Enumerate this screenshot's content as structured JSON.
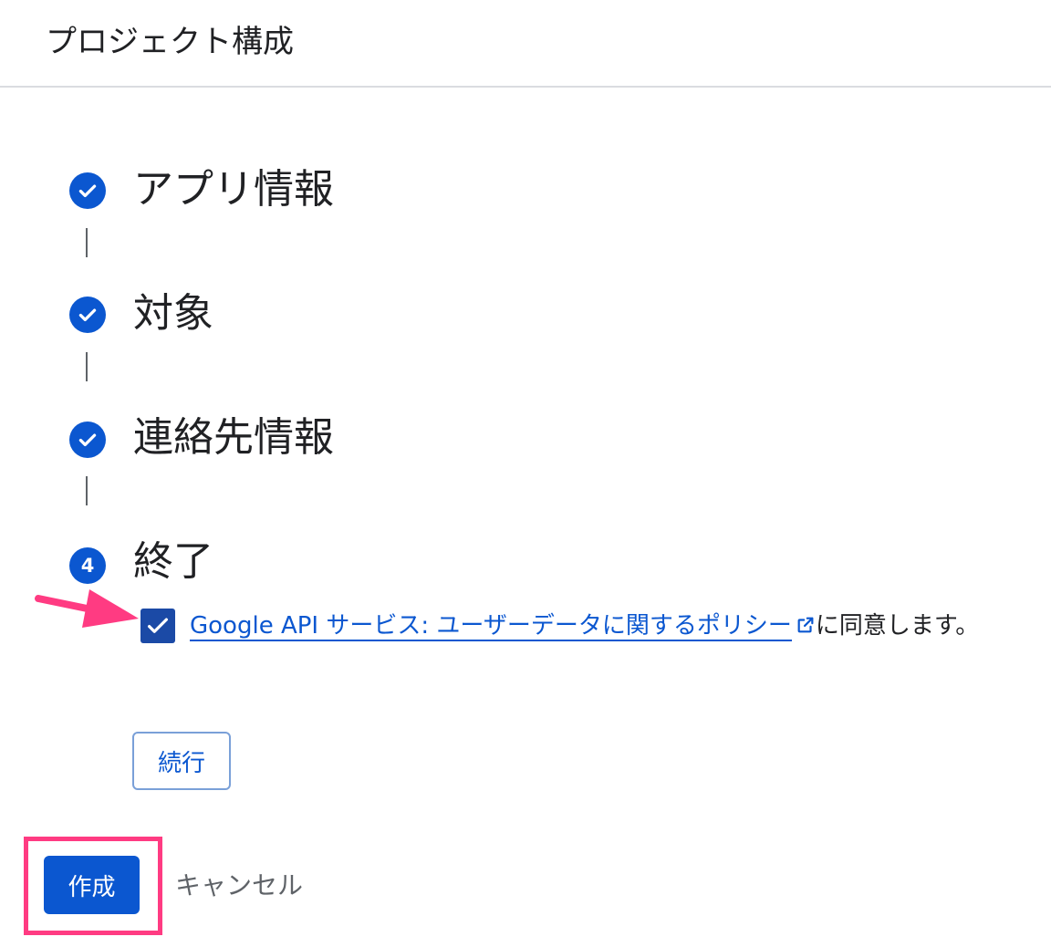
{
  "header": {
    "title": "プロジェクト構成"
  },
  "steps": [
    {
      "label": "アプリ情報",
      "status": "complete"
    },
    {
      "label": "対象",
      "status": "complete"
    },
    {
      "label": "連絡先情報",
      "status": "complete"
    },
    {
      "label": "終了",
      "status": "current",
      "number": "4"
    }
  ],
  "consent": {
    "checked": true,
    "link_text": "Google API サービス: ユーザーデータに関するポリシー",
    "suffix_text": "に同意します。"
  },
  "buttons": {
    "continue_label": "続行",
    "create_label": "作成",
    "cancel_label": "キャンセル"
  },
  "colors": {
    "primary": "#0b57d0",
    "checkbox": "#1b4aa6",
    "highlight": "#ff3b82",
    "text": "#202124",
    "secondary_text": "#5f6368"
  }
}
